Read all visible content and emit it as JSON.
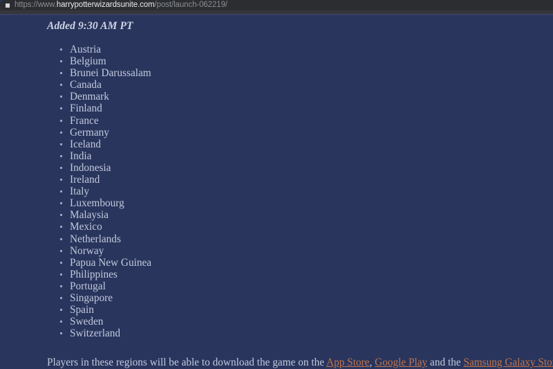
{
  "browser": {
    "site_icon": "square-site-icon",
    "url_scheme": "https://www.",
    "url_domain": "harrypotterwizardsunite.com",
    "url_path": "/post/launch-062219/",
    "url_full": "https://www.harrypotterwizardsunite.com/post/launch-062219/"
  },
  "colors": {
    "page_background": "#29355d",
    "browser_bar_background": "#2b2d30",
    "body_text": "#c3c9dd",
    "heading_text": "#cfd4e4",
    "link_accent": "#c0764f",
    "bullet_marker": "#9aa2bd"
  },
  "article": {
    "heading": "Added 9:30 AM PT",
    "countries": [
      "Austria",
      "Belgium",
      "Brunei Darussalam",
      "Canada",
      "Denmark",
      "Finland",
      "France",
      "Germany",
      "Iceland",
      "India",
      "Indonesia",
      "Ireland",
      "Italy",
      "Luxembourg",
      "Malaysia",
      "Mexico",
      "Netherlands",
      "Norway",
      "Papua New Guinea",
      "Philippines",
      "Portugal",
      "Singapore",
      "Spain",
      "Sweden",
      "Switzerland"
    ],
    "closing_paragraph": {
      "text_before_links": "Players in these regions will be able to download the game on the ",
      "link_app_store": "App Store",
      "separator_1": ", ",
      "link_google_play": "Google Play",
      "separator_2": " and the ",
      "link_samsung_galaxy_store": "Samsung Galaxy Store",
      "separator_3": ".",
      "full_text": "Players in these regions will be able to download the game on the App Store, Google Play and the Samsung Galaxy Store."
    }
  }
}
